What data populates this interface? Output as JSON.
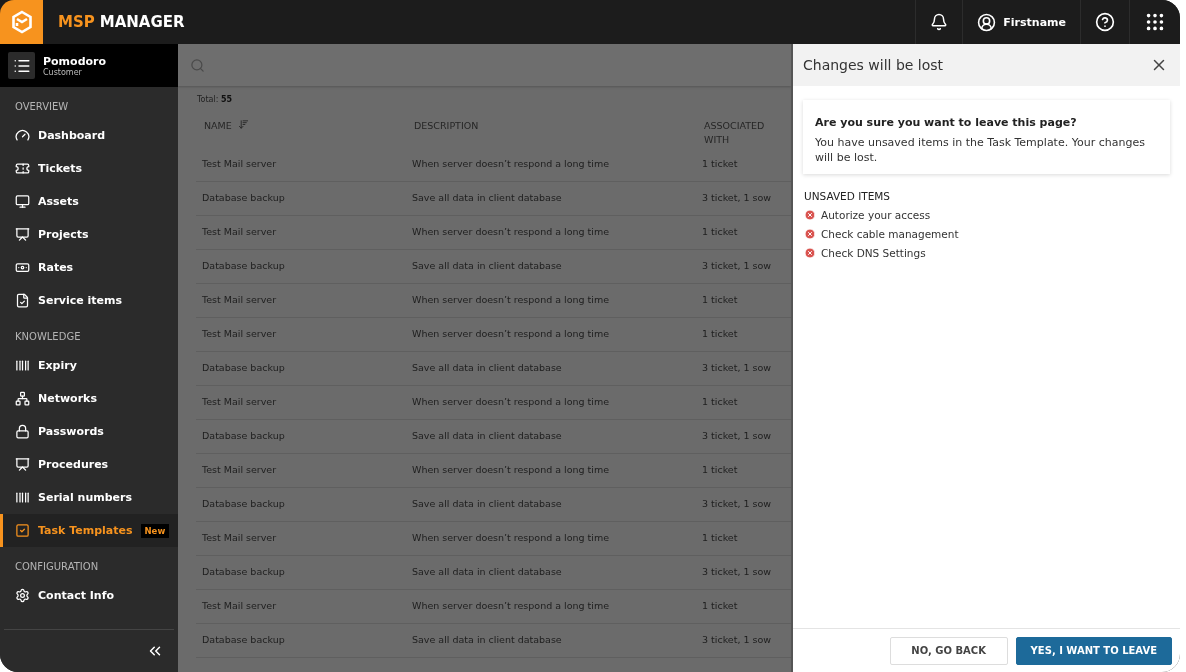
{
  "header": {
    "brand_accent": "MSP",
    "brand": "MANAGER",
    "user": "Firstname"
  },
  "customer": {
    "name": "Pomodoro",
    "role": "Customer"
  },
  "sidebar": {
    "sections": [
      {
        "heading": "OVERVIEW",
        "items": [
          {
            "label": "Dashboard",
            "selected": false
          },
          {
            "label": "Tickets",
            "selected": false
          },
          {
            "label": "Assets",
            "selected": false
          },
          {
            "label": "Projects",
            "selected": false
          },
          {
            "label": "Rates",
            "selected": false
          },
          {
            "label": "Service items",
            "selected": false
          }
        ]
      },
      {
        "heading": "KNOWLEDGE",
        "items": [
          {
            "label": "Expiry",
            "selected": false
          },
          {
            "label": "Networks",
            "selected": false
          },
          {
            "label": "Passwords",
            "selected": false
          },
          {
            "label": "Procedures",
            "selected": false
          },
          {
            "label": "Serial numbers",
            "selected": false
          },
          {
            "label": "Task Templates",
            "selected": true,
            "badge": "New"
          }
        ]
      },
      {
        "heading": "CONFIGURATION",
        "items": [
          {
            "label": "Contact Info",
            "selected": false
          }
        ]
      }
    ]
  },
  "list": {
    "total": "Total: **55**",
    "columns": [
      "NAME",
      "DESCRIPTION",
      "ASSOCIATED WITH"
    ],
    "rows": [
      [
        "Test Mail server",
        "When server doesn’t respond a long time",
        "1 ticket"
      ],
      [
        "Database backup",
        "Save all data in client database",
        "3 ticket, 1 sow"
      ],
      [
        "Test Mail server",
        "When server doesn’t respond a long time",
        "1 ticket"
      ],
      [
        "Database backup",
        "Save all data in client database",
        "3 ticket, 1 sow"
      ],
      [
        "Test Mail server",
        "When server doesn’t respond a long time",
        "1 ticket"
      ],
      [
        "Test Mail server",
        "When server doesn’t respond a long time",
        "1 ticket"
      ],
      [
        "Database backup",
        "Save all data in client database",
        "3 ticket, 1 sow"
      ],
      [
        "Test Mail server",
        "When server doesn’t respond a long time",
        "1 ticket"
      ],
      [
        "Database backup",
        "Save all data in client database",
        "3 ticket, 1 sow"
      ],
      [
        "Test Mail server",
        "When server doesn’t respond a long time",
        "1 ticket"
      ],
      [
        "Database backup",
        "Save all data in client database",
        "3 ticket, 1 sow"
      ],
      [
        "Test Mail server",
        "When server doesn’t respond a long time",
        "1 ticket"
      ],
      [
        "Database backup",
        "Save all data in client database",
        "3 ticket, 1 sow"
      ],
      [
        "Test Mail server",
        "When server doesn’t respond a long time",
        "1 ticket"
      ],
      [
        "Database backup",
        "Save all data in client database",
        "3 ticket, 1 sow"
      ]
    ]
  },
  "dialog": {
    "title": "Changes will be lost",
    "heading": "Are you sure you want to leave this page?",
    "message": "You have unsaved items in the Task Template. Your changes will be lost.",
    "unsaved_heading": "UNSAVED ITEMS",
    "unsaved_items": [
      "Autorize your access",
      "Check cable management",
      "Check DNS Settings"
    ],
    "buttons": [
      {
        "label": "NO, GO BACK",
        "kind": "secondary"
      },
      {
        "label": "YES, I WANT TO LEAVE",
        "kind": "primary"
      }
    ]
  }
}
